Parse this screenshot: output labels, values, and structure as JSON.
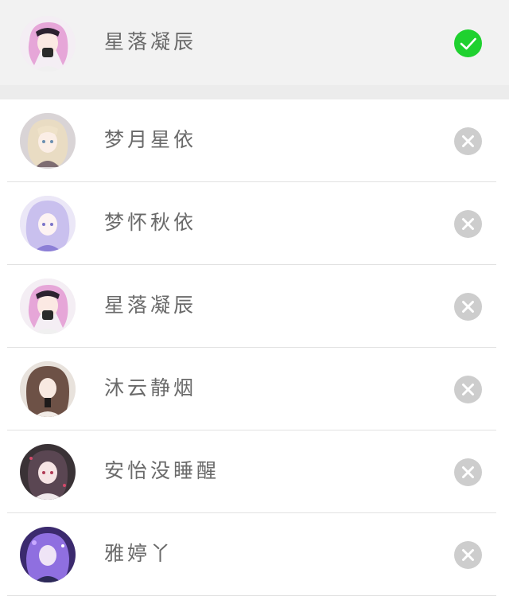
{
  "current_account": {
    "name": "星落凝辰",
    "avatar": "anime-girl-pink-hair-avatar",
    "status_icon": "checkmark-icon",
    "status_color": "#1fd12f"
  },
  "accounts": [
    {
      "name": "梦月星依",
      "avatar": "anime-girl-blonde-avatar",
      "action_icon": "close-icon"
    },
    {
      "name": "梦怀秋依",
      "avatar": "anime-girl-lavender-avatar",
      "action_icon": "close-icon"
    },
    {
      "name": "星落凝辰",
      "avatar": "anime-girl-pink-hair-avatar",
      "action_icon": "close-icon"
    },
    {
      "name": "沐云静烟",
      "avatar": "anime-girl-brown-hair-avatar",
      "action_icon": "close-icon"
    },
    {
      "name": "安怡没睡醒",
      "avatar": "anime-girl-dark-avatar",
      "action_icon": "close-icon"
    },
    {
      "name": "雅婷丫",
      "avatar": "anime-girl-purple-avatar",
      "action_icon": "close-icon"
    }
  ],
  "colors": {
    "remove_icon_bg": "#cdcdcd",
    "name_text": "#6a6a6a"
  }
}
